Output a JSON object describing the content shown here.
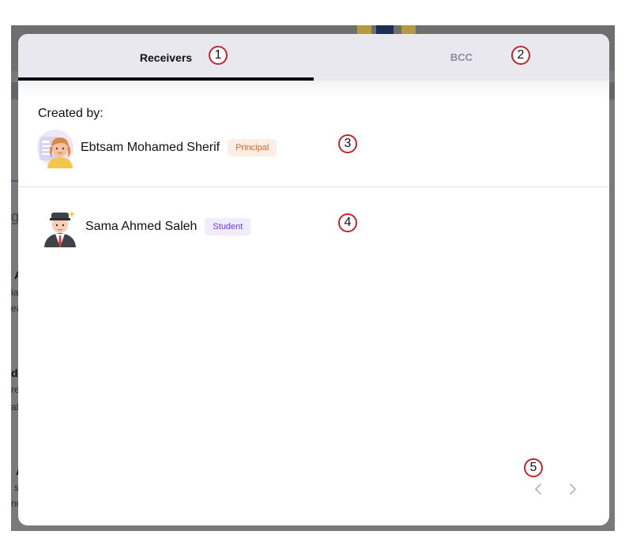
{
  "tabs": [
    {
      "label": "Receivers",
      "active": true
    },
    {
      "label": "BCC",
      "active": false
    }
  ],
  "created_by": {
    "heading": "Created by:",
    "name": "Ebtsam Mohamed Sherif",
    "role": "Principal",
    "avatar_icon": "principal-avatar-icon"
  },
  "receivers": [
    {
      "name": "Sama Ahmed Saleh",
      "role": "Student",
      "avatar_icon": "student-avatar-icon"
    }
  ],
  "pagination": {
    "prev_icon": "chevron-left-icon",
    "next_icon": "chevron-right-icon"
  },
  "markers": [
    "1",
    "2",
    "3",
    "4",
    "5"
  ],
  "background": {
    "fragments": [
      "g",
      "A",
      "ia",
      "ea",
      "d",
      "re",
      "al",
      "A",
      "s",
      "nc"
    ]
  },
  "colors": {
    "principal_badge_bg": "#fdeee5",
    "principal_badge_text": "#c86a3a",
    "student_badge_bg": "#f1ecfd",
    "student_badge_text": "#6f3bd3",
    "active_tab_indicator": "#0a0a0a",
    "marker_ring": "#c0262c"
  }
}
